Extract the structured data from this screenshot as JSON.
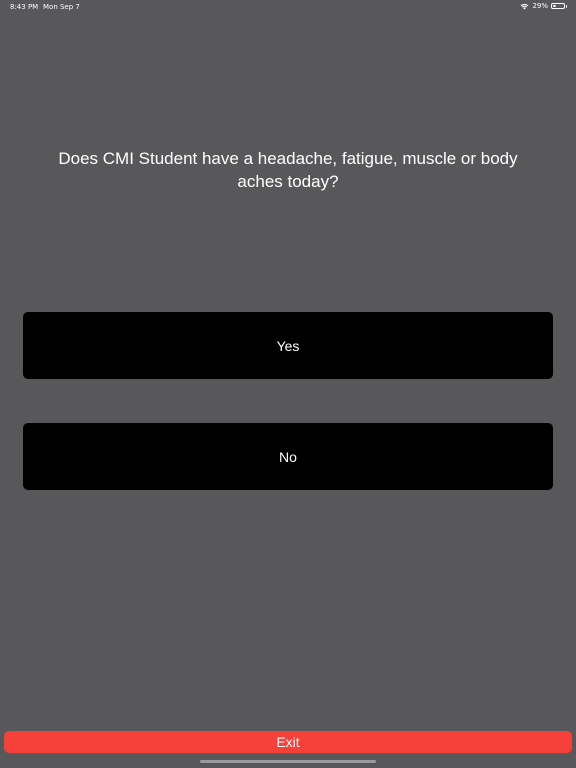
{
  "status_bar": {
    "time": "8:43 PM",
    "date": "Mon Sep 7",
    "battery": "29%",
    "battery_level": 0.29
  },
  "question": {
    "text": "Does CMI Student have a headache, fatigue, muscle or body aches today?"
  },
  "answers": {
    "yes_label": "Yes",
    "no_label": "No"
  },
  "footer": {
    "exit_label": "Exit"
  },
  "colors": {
    "background": "#58575a",
    "button_bg": "#000000",
    "exit_bg": "#f5413a",
    "text": "#ffffff"
  }
}
